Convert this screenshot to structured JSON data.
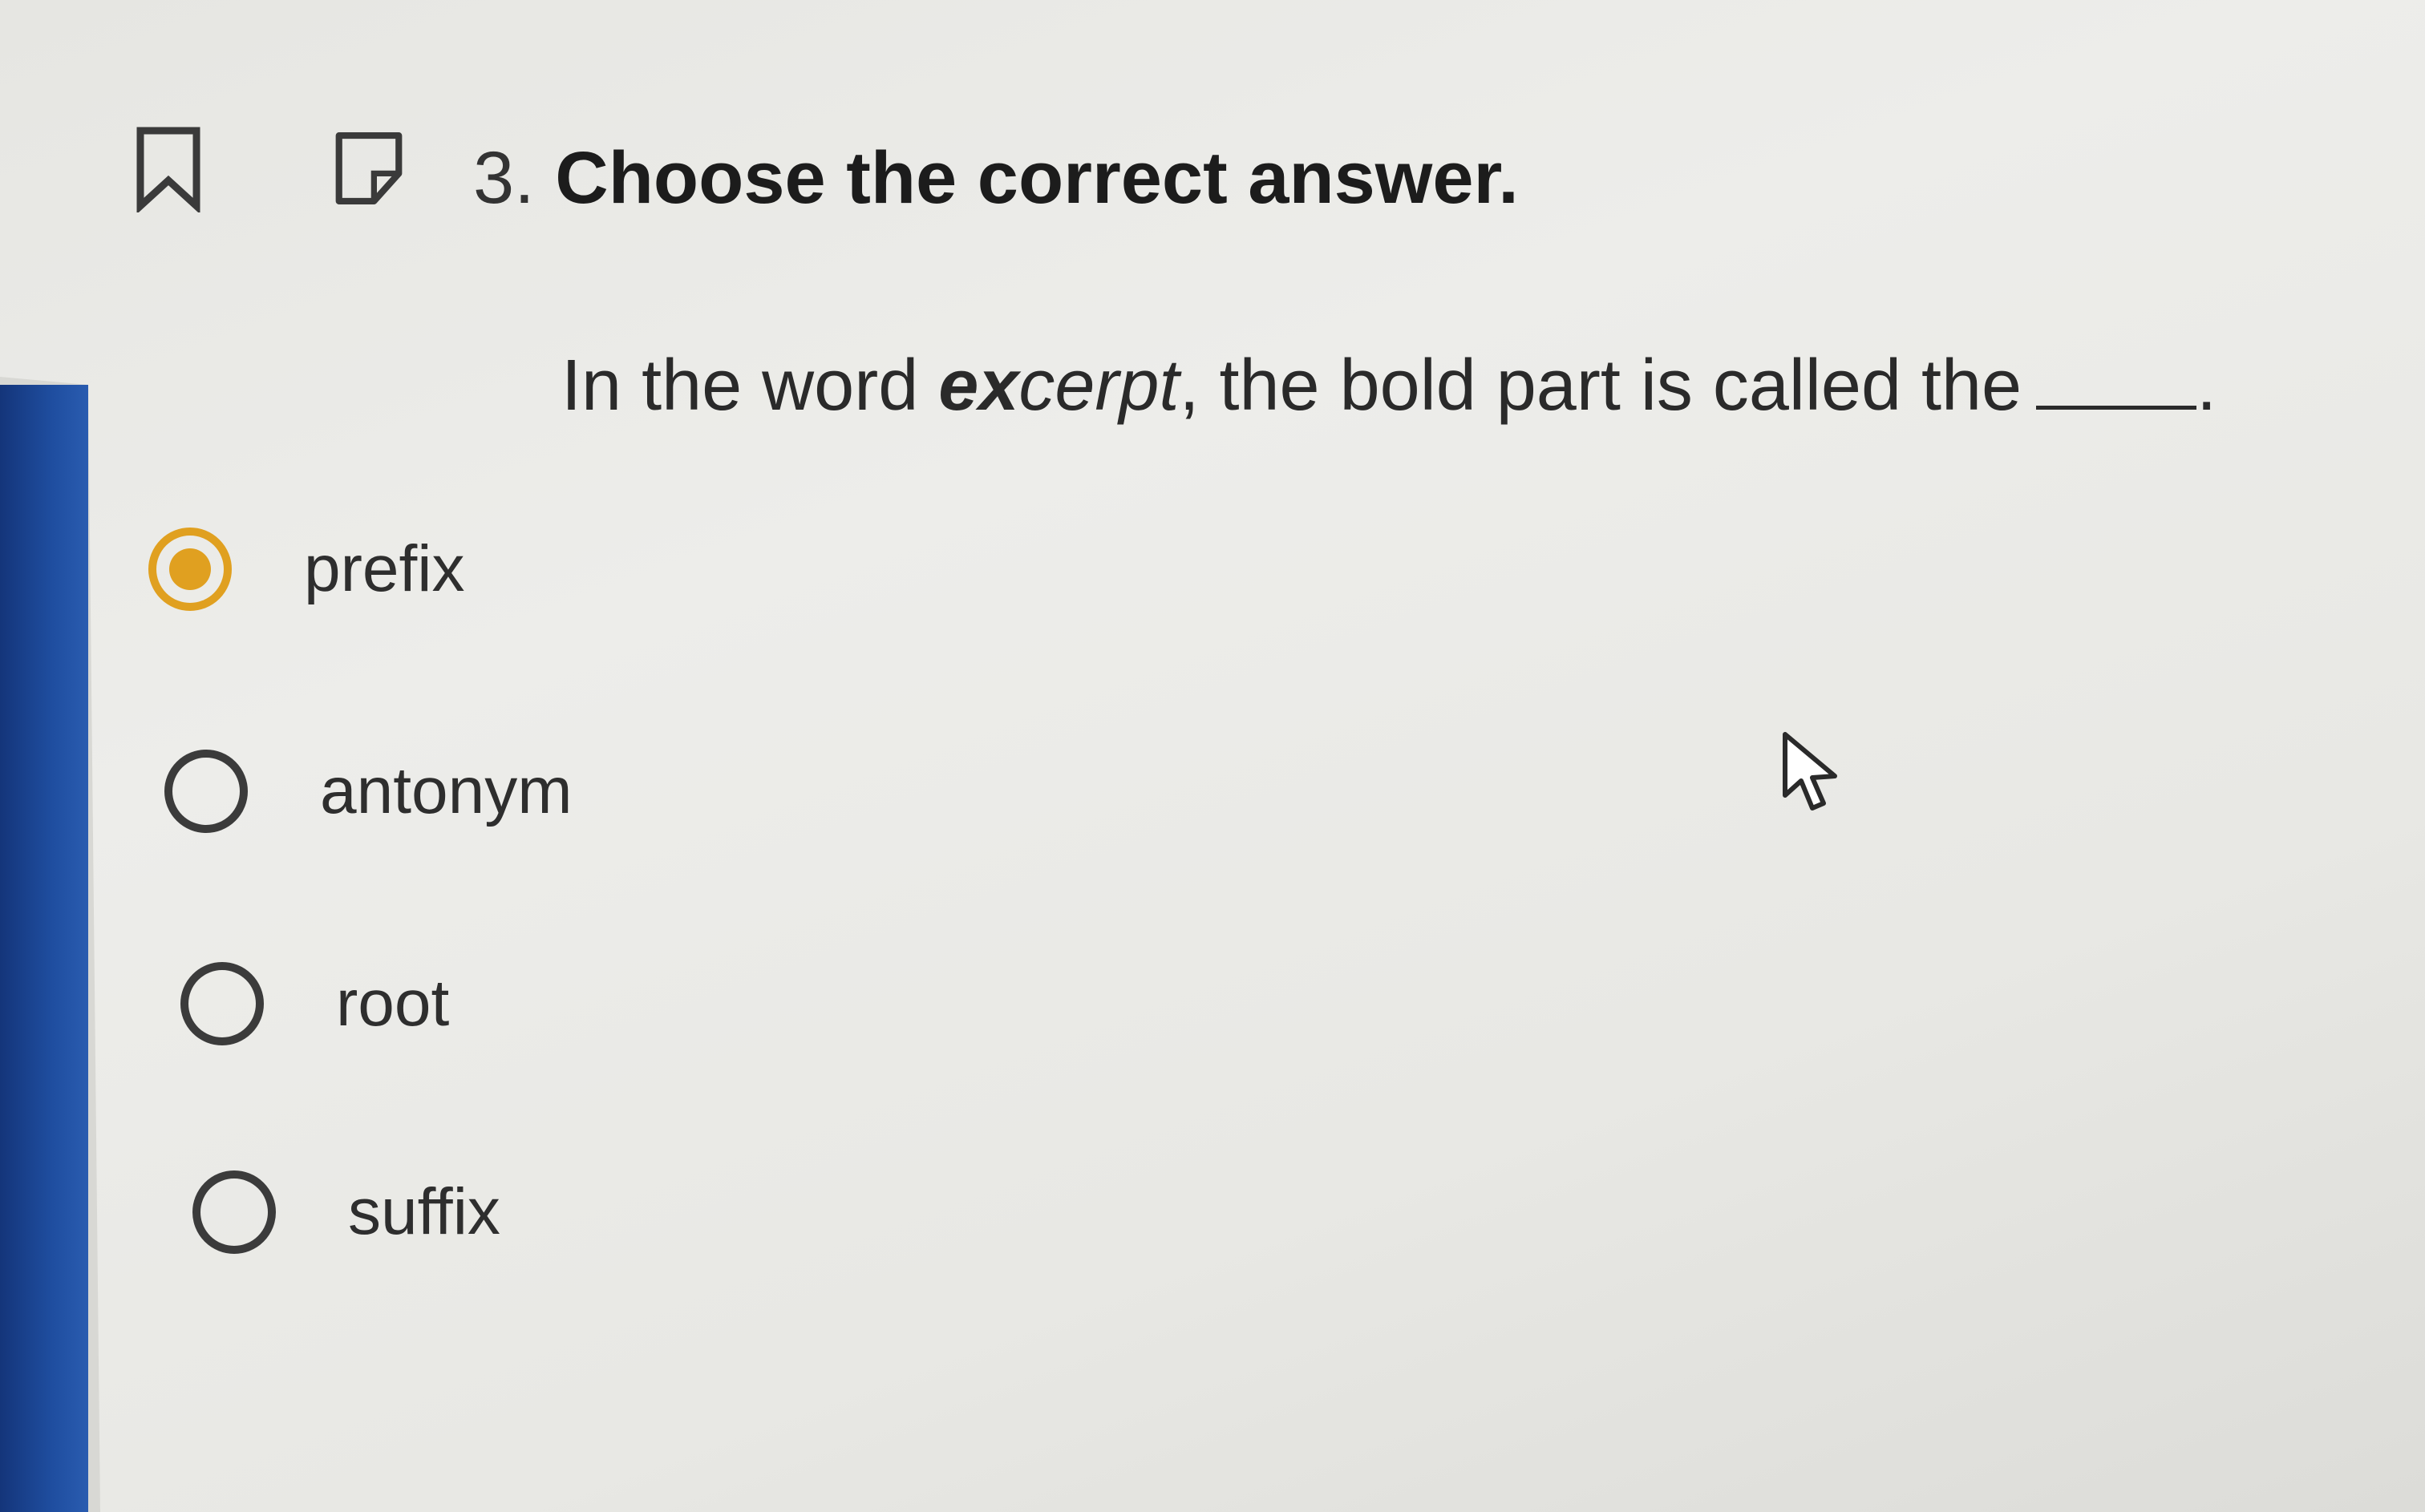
{
  "question": {
    "number": "3.",
    "title": "Choose the correct answer.",
    "text_before": "In the word ",
    "word_bold_part": "ex",
    "word_rest": "cerpt",
    "text_after": ", the bold part is called the",
    "text_end": "."
  },
  "icons": {
    "bookmark": "bookmark-icon",
    "note": "note-icon"
  },
  "options": [
    {
      "label": "prefix",
      "selected": true
    },
    {
      "label": "antonym",
      "selected": false
    },
    {
      "label": "root",
      "selected": false
    },
    {
      "label": "suffix",
      "selected": false
    }
  ],
  "colors": {
    "selected_accent": "#e0a020",
    "left_bar": "#1f4ea0"
  }
}
